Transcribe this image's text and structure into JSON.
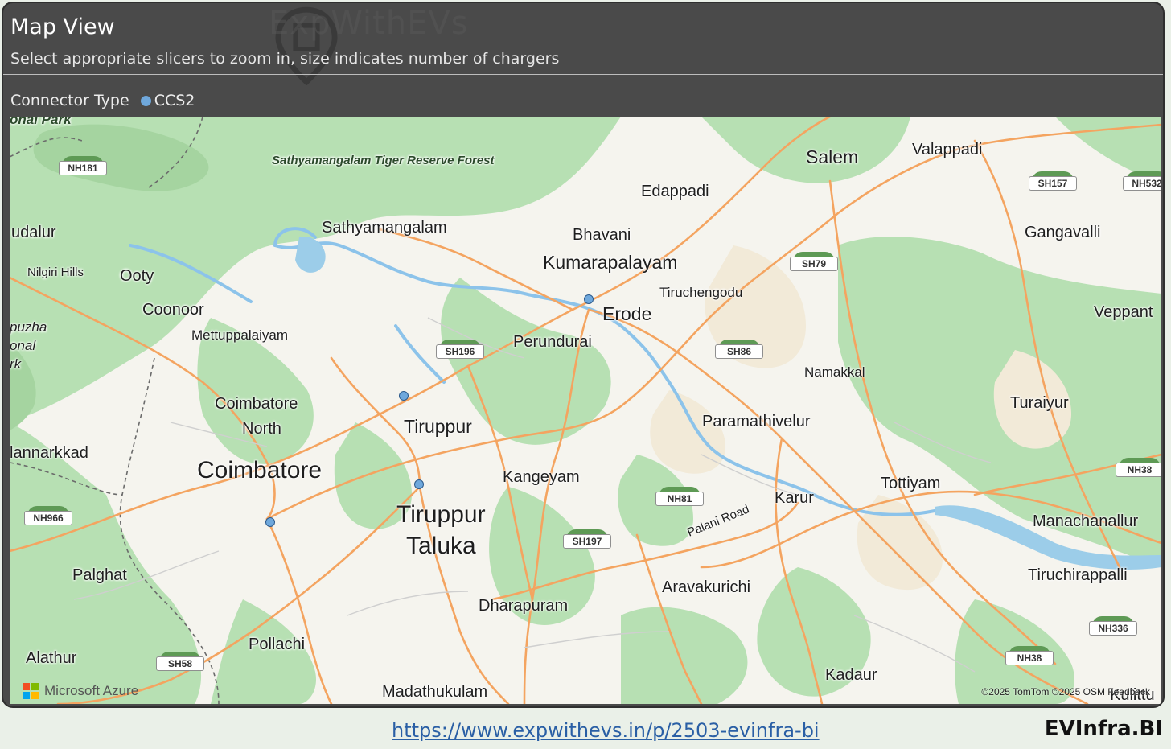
{
  "header": {
    "title": "Map View",
    "subtitle": "Select appropriate slicers to zoom in, size indicates number of chargers",
    "watermark": "ExpWithEVs"
  },
  "legend": {
    "label": "Connector Type",
    "items": [
      {
        "name": "CCS2",
        "color": "#6fa8dc"
      }
    ]
  },
  "map": {
    "places": [
      {
        "id": "salem",
        "text": "Salem"
      },
      {
        "id": "valappadi",
        "text": "Valappadi"
      },
      {
        "id": "edappadi",
        "text": "Edappadi"
      },
      {
        "id": "bhavani",
        "text": "Bhavani"
      },
      {
        "id": "kumarapalayam",
        "text": "Kumarapalayam"
      },
      {
        "id": "tiruchengodu",
        "text": "Tiruchengodu"
      },
      {
        "id": "erode",
        "text": "Erode"
      },
      {
        "id": "gangavalli",
        "text": "Gangavalli"
      },
      {
        "id": "veppant",
        "text": "Veppant"
      },
      {
        "id": "sathyamangalam",
        "text": "Sathyamangalam"
      },
      {
        "id": "tiger_reserve",
        "text": "Sathyamangalam Tiger Reserve Forest"
      },
      {
        "id": "udalur",
        "text": "udalur"
      },
      {
        "id": "nilgiri",
        "text": "Nilgiri Hills"
      },
      {
        "id": "ooty",
        "text": "Ooty"
      },
      {
        "id": "coonoor",
        "text": "Coonoor"
      },
      {
        "id": "mettuppalaiyam",
        "text": "Mettuppalaiyam"
      },
      {
        "id": "perundurai",
        "text": "Perundurai"
      },
      {
        "id": "namakkal",
        "text": "Namakkal"
      },
      {
        "id": "turaiyur",
        "text": "Turaiyur"
      },
      {
        "id": "coimbatore_north_1",
        "text": "Coimbatore"
      },
      {
        "id": "coimbatore_north_2",
        "text": "North"
      },
      {
        "id": "tiruppur",
        "text": "Tiruppur"
      },
      {
        "id": "paramathivelur",
        "text": "Paramathivelur"
      },
      {
        "id": "mannarkkad",
        "text": "lannarkkad"
      },
      {
        "id": "coimbatore",
        "text": "Coimbatore"
      },
      {
        "id": "kangeyam",
        "text": "Kangeyam"
      },
      {
        "id": "tottiyam",
        "text": "Tottiyam"
      },
      {
        "id": "karur",
        "text": "Karur"
      },
      {
        "id": "tiruppur_taluka_1",
        "text": "Tiruppur"
      },
      {
        "id": "tiruppur_taluka_2",
        "text": "Taluka"
      },
      {
        "id": "manachanallur",
        "text": "Manachanallur"
      },
      {
        "id": "palani_road",
        "text": "Palani Road"
      },
      {
        "id": "palghat",
        "text": "Palghat"
      },
      {
        "id": "aravakurichi",
        "text": "Aravakurichi"
      },
      {
        "id": "tiruchirappalli",
        "text": "Tiruchirappalli"
      },
      {
        "id": "dharapuram",
        "text": "Dharapuram"
      },
      {
        "id": "pollachi",
        "text": "Pollachi"
      },
      {
        "id": "alathur",
        "text": "Alathur"
      },
      {
        "id": "kadaur",
        "text": "Kadaur"
      },
      {
        "id": "madathukulam",
        "text": "Madathukulam"
      },
      {
        "id": "kulittu",
        "text": "Kulittu"
      },
      {
        "id": "park",
        "text": "onal Park"
      },
      {
        "id": "puzha",
        "text": "puzha"
      },
      {
        "id": "onal",
        "text": "onal"
      },
      {
        "id": "rk",
        "text": "rk"
      }
    ],
    "shields": [
      {
        "id": "nh181",
        "text": "NH181"
      },
      {
        "id": "sh157",
        "text": "SH157"
      },
      {
        "id": "nh532",
        "text": "NH532"
      },
      {
        "id": "sh79",
        "text": "SH79"
      },
      {
        "id": "sh196",
        "text": "SH196"
      },
      {
        "id": "sh86",
        "text": "SH86"
      },
      {
        "id": "nh38a",
        "text": "NH38"
      },
      {
        "id": "nh81",
        "text": "NH81"
      },
      {
        "id": "nh966",
        "text": "NH966"
      },
      {
        "id": "sh197",
        "text": "SH197"
      },
      {
        "id": "nh336",
        "text": "NH336"
      },
      {
        "id": "nh38b",
        "text": "NH38"
      },
      {
        "id": "sh58",
        "text": "SH58"
      }
    ],
    "chargers": [
      {
        "connector": "CCS2",
        "near": "Erode"
      },
      {
        "connector": "CCS2",
        "near": "Tiruppur"
      },
      {
        "connector": "CCS2",
        "near": "Tiruppur Taluka"
      },
      {
        "connector": "CCS2",
        "near": "Coimbatore"
      }
    ],
    "provider": "Microsoft Azure",
    "copyright": "©2025 TomTom  ©2025 OSM  Feedback"
  },
  "footer": {
    "link": "https://www.expwithevs.in/p/2503-evinfra-bi",
    "brand": "EVInfra.BI"
  }
}
